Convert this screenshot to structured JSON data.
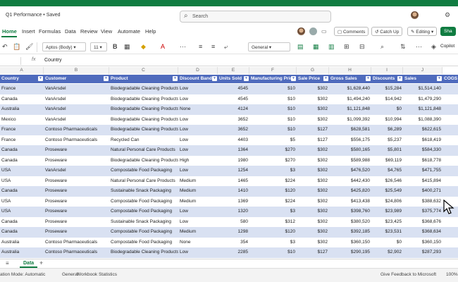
{
  "app": {
    "title": "Q1 Performance • Saved",
    "search_label": "Search",
    "brand_color": "#107c41",
    "header_fill": "#4f6bbd",
    "band_fill": "#d9e1f2"
  },
  "ribbon": {
    "tabs": [
      "Home",
      "Insert",
      "Formulas",
      "Data",
      "Review",
      "View",
      "Automate",
      "Help"
    ],
    "active_tab": "Home",
    "comments_label": "Comments",
    "catchup_label": "Catch Up",
    "editing_label": "Editing",
    "share_label": "Sha"
  },
  "toolbar": {
    "font_name": "Aptos (Body)",
    "font_size": "11",
    "bold": "B",
    "number_format": "General",
    "copilot_label": "Copilot"
  },
  "formula_bar": {
    "fx": "fx",
    "value": "Country"
  },
  "grid": {
    "column_letters": [
      "A",
      "B",
      "C",
      "D",
      "E",
      "F",
      "G",
      "H",
      "I",
      "J"
    ],
    "headers": [
      "Country",
      "Customer",
      "Product",
      "Discount Band",
      "Units Sold",
      "Manufacturing Price",
      "Sale Price",
      "Gross Sales",
      "Discounts",
      "Sales",
      "COGS"
    ],
    "rows": [
      [
        "France",
        "VanArsdel",
        "Biodegradable Cleaning Products",
        "Low",
        "4545",
        "$10",
        "$302",
        "$1,628,440",
        "$15,284",
        "$1,514,140"
      ],
      [
        "Canada",
        "VanArsdel",
        "Biodegradable Cleaning Products",
        "Low",
        "4545",
        "$10",
        "$302",
        "$1,494,240",
        "$14,942",
        "$1,479,290"
      ],
      [
        "Australia",
        "VanArsdel",
        "Biodegradable Cleaning Products",
        "None",
        "4124",
        "$10",
        "$302",
        "$1,121,848",
        "$0",
        "$1,121,848"
      ],
      [
        "Mexico",
        "VanArsdel",
        "Biodegradable Cleaning Products",
        "Low",
        "3652",
        "$10",
        "$302",
        "$1,099,392",
        "$10,994",
        "$1,088,390"
      ],
      [
        "France",
        "Contoso Pharmaceuticals",
        "Biodegradable Cleaning Products",
        "Low",
        "3652",
        "$10",
        "$127",
        "$628,581",
        "$6,289",
        "$622,615"
      ],
      [
        "France",
        "Contoso Pharmaceuticals",
        "Recycled Can",
        "Low",
        "4403",
        "$5",
        "$127",
        "$556,175",
        "$5,237",
        "$618,419"
      ],
      [
        "Canada",
        "Proseware",
        "Natural Personal Care Products",
        "Low",
        "1364",
        "$270",
        "$302",
        "$580,165",
        "$5,801",
        "$584,330"
      ],
      [
        "Canada",
        "Proseware",
        "Biodegradable Cleaning Products",
        "High",
        "1980",
        "$270",
        "$302",
        "$589,988",
        "$69,119",
        "$618,778"
      ],
      [
        "USA",
        "VanArsdel",
        "Compostable Food Packaging",
        "Low",
        "1254",
        "$3",
        "$302",
        "$476,520",
        "$4,765",
        "$471,755"
      ],
      [
        "USA",
        "Proseware",
        "Natural Personal Care Products",
        "Medium",
        "1465",
        "$224",
        "$302",
        "$442,430",
        "$26,546",
        "$415,894"
      ],
      [
        "Canada",
        "Proseware",
        "Sustainable Snack Packaging",
        "Medium",
        "1410",
        "$120",
        "$302",
        "$425,820",
        "$25,549",
        "$400,271"
      ],
      [
        "USA",
        "Proseware",
        "Compostable Food Packaging",
        "Medium",
        "1369",
        "$224",
        "$302",
        "$413,438",
        "$24,806",
        "$388,632"
      ],
      [
        "USA",
        "Proseware",
        "Compostable Food Packaging",
        "Low",
        "1320",
        "$3",
        "$302",
        "$398,760",
        "$23,989",
        "$375,774"
      ],
      [
        "Canada",
        "Proseware",
        "Sustainable Snack Packaging",
        "Low",
        "580",
        "$312",
        "$302",
        "$380,520",
        "$23,425",
        "$368,676"
      ],
      [
        "Canada",
        "Proseware",
        "Compostable Food Packaging",
        "Medium",
        "1298",
        "$120",
        "$302",
        "$392,185",
        "$23,531",
        "$368,634"
      ],
      [
        "Australia",
        "Contoso Pharmaceuticals",
        "Compostable Food Packaging",
        "None",
        "354",
        "$3",
        "$302",
        "$360,150",
        "$0",
        "$360,150"
      ],
      [
        "Australia",
        "Contoso Pharmaceuticals",
        "Biodegradable Cleaning Products",
        "Low",
        "2285",
        "$10",
        "$127",
        "$290,195",
        "$2,902",
        "$287,293"
      ]
    ]
  },
  "sheets": {
    "active_label": "Data",
    "add_label": "+"
  },
  "status": {
    "mode": "ation Mode: Automatic",
    "format": "General",
    "workbook_stats": "Workbook Statistics",
    "feedback": "Give Feedback to Microsoft",
    "zoom": "100%"
  }
}
